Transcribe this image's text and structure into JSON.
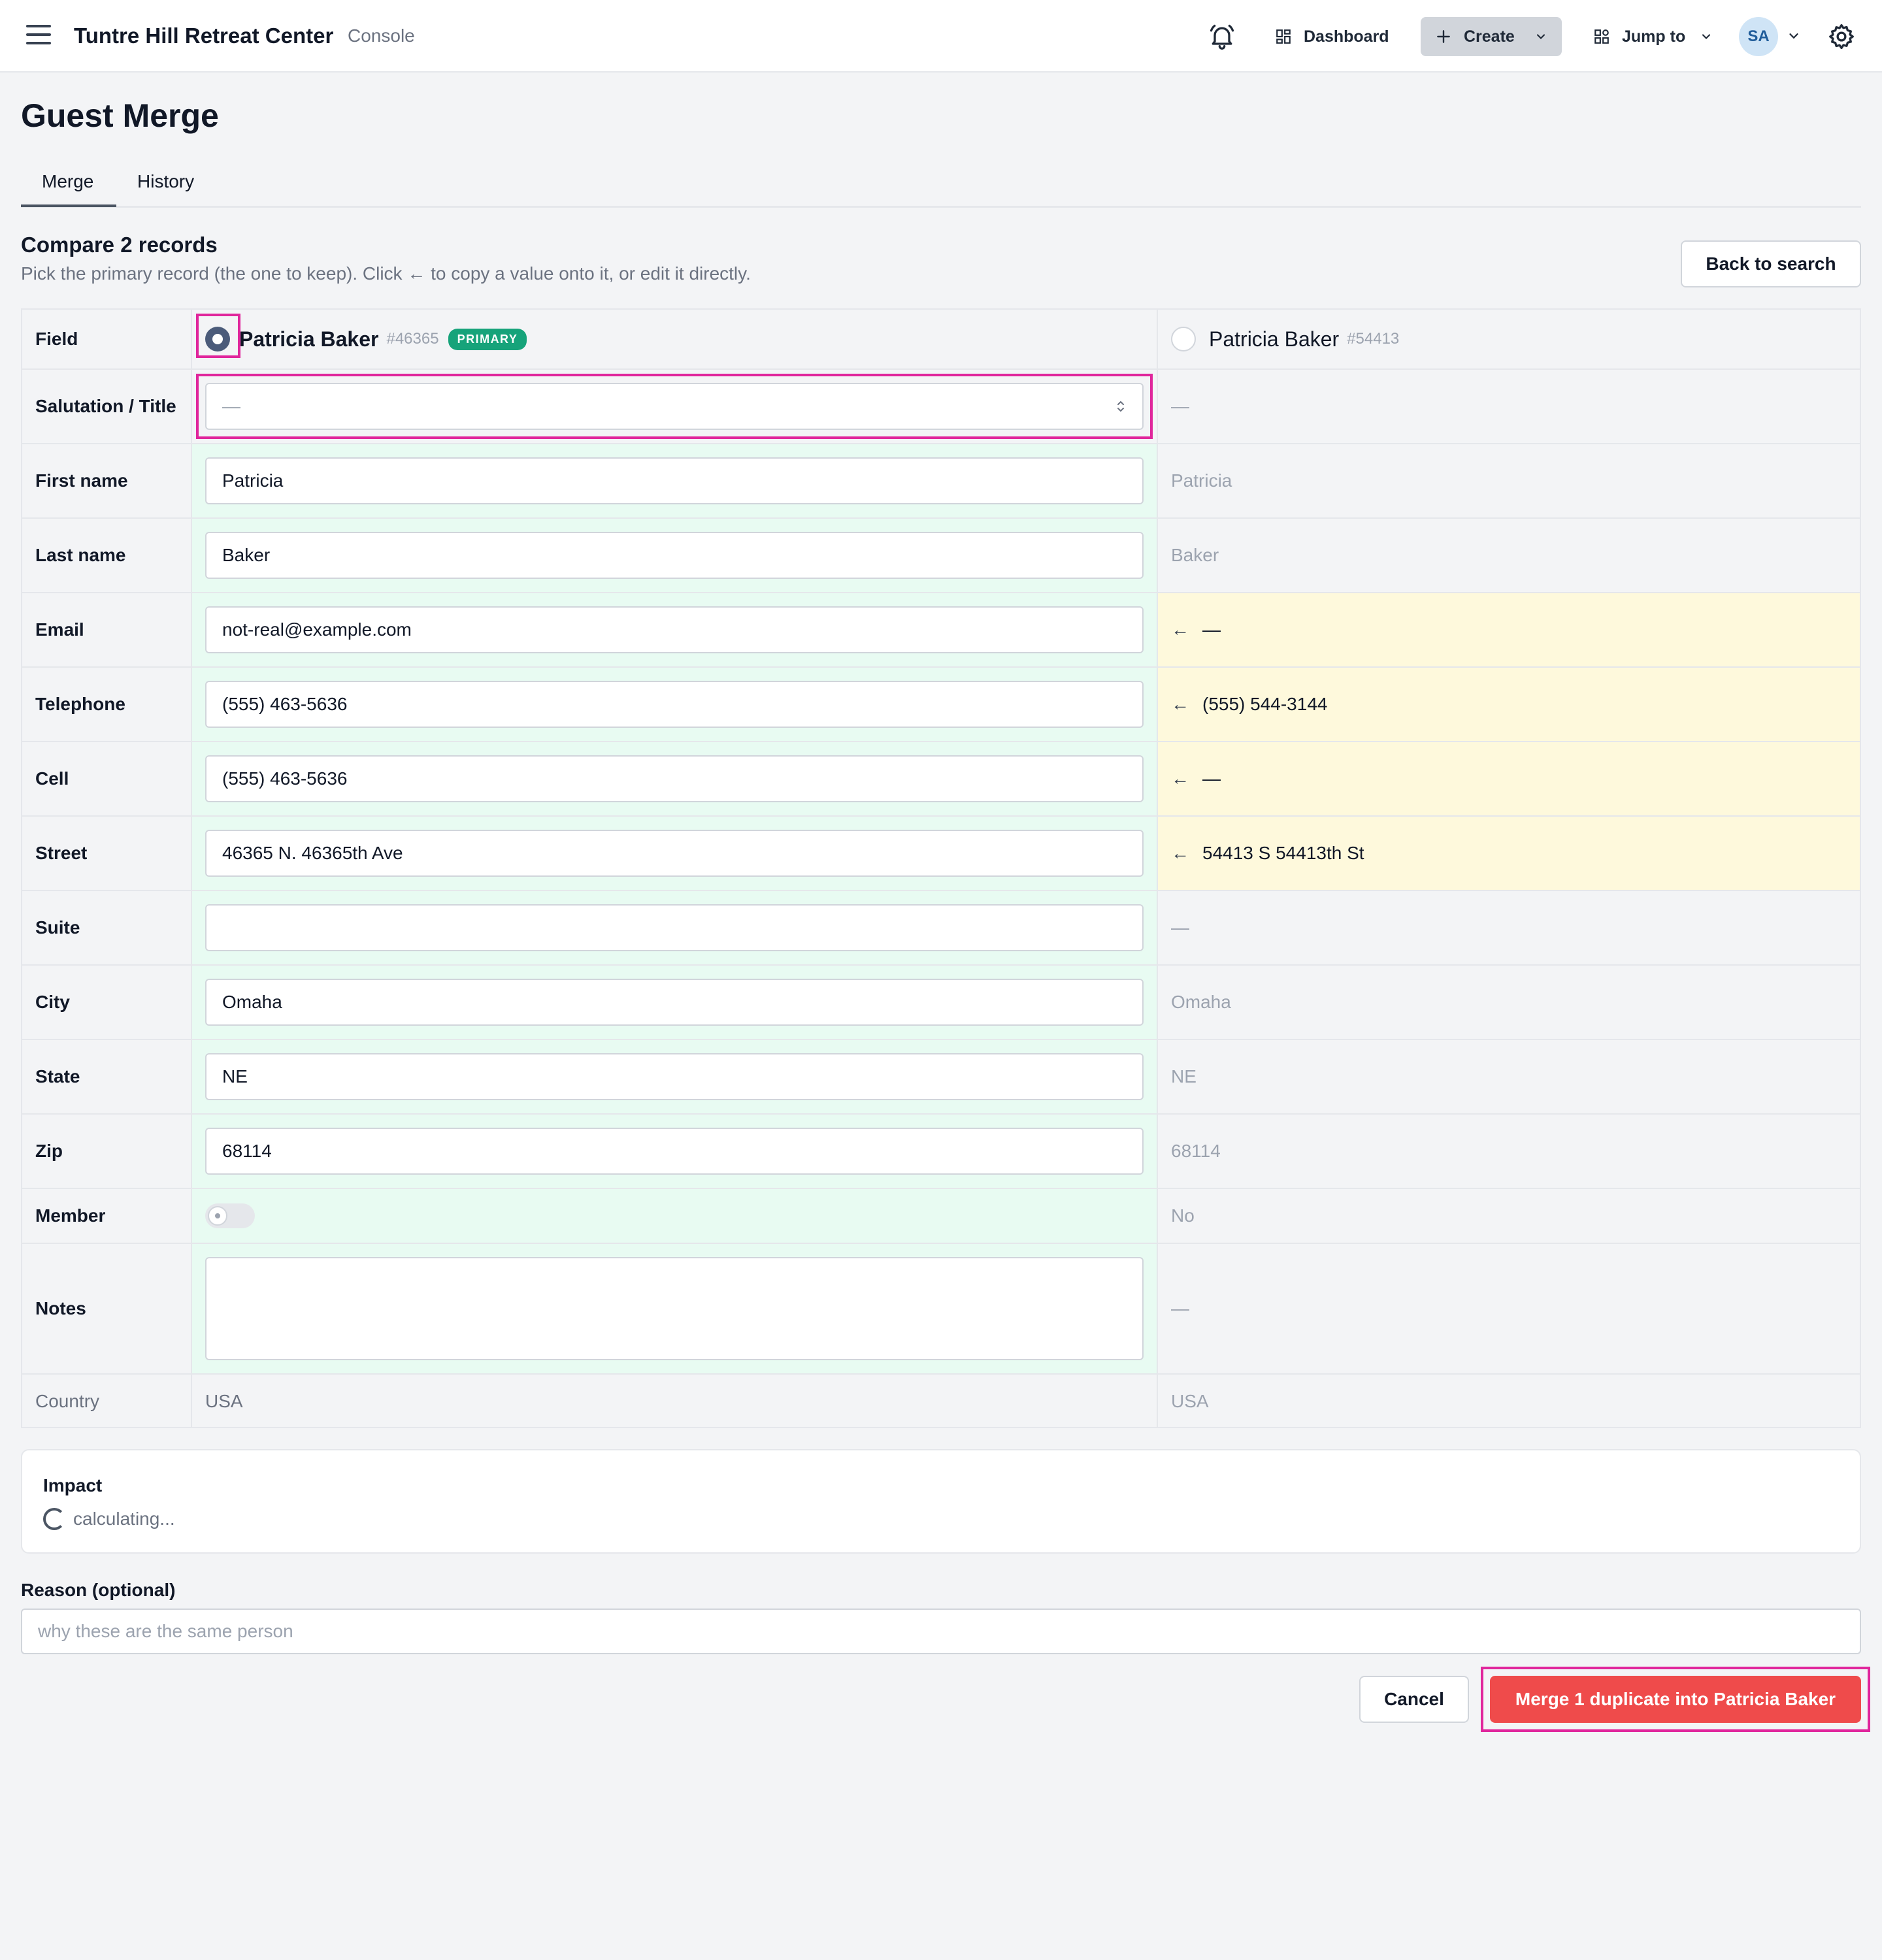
{
  "header": {
    "app_title": "Tuntre Hill Retreat Center",
    "app_subtitle": "Console",
    "dashboard_label": "Dashboard",
    "create_label": "Create",
    "jump_label": "Jump to",
    "avatar_initials": "SA"
  },
  "page": {
    "title": "Guest Merge",
    "tabs": [
      {
        "label": "Merge",
        "active": true
      },
      {
        "label": "History",
        "active": false
      }
    ]
  },
  "compare": {
    "title": "Compare 2 records",
    "subtitle": "Pick the primary record (the one to keep). Click ← to copy a value onto it, or edit it directly.",
    "back_label": "Back to search"
  },
  "records": {
    "field_header": "Field",
    "primary": {
      "name": "Patricia Baker",
      "id": "#46365",
      "badge": "PRIMARY"
    },
    "duplicate": {
      "name": "Patricia Baker",
      "id": "#54413"
    }
  },
  "rows": [
    {
      "label": "Salutation / Title",
      "primary": "—",
      "duplicate": "—"
    },
    {
      "label": "First name",
      "primary": "Patricia",
      "duplicate": "Patricia"
    },
    {
      "label": "Last name",
      "primary": "Baker",
      "duplicate": "Baker"
    },
    {
      "label": "Email",
      "primary": "not-real@example.com",
      "duplicate": "—",
      "copy_arrow": "←"
    },
    {
      "label": "Telephone",
      "primary": "(555) 463-5636",
      "duplicate": "(555) 544-3144",
      "copy_arrow": "←"
    },
    {
      "label": "Cell",
      "primary": "(555) 463-5636",
      "duplicate": "—",
      "copy_arrow": "←"
    },
    {
      "label": "Street",
      "primary": "46365 N. 46365th Ave",
      "duplicate": "54413 S 54413th St",
      "copy_arrow": "←"
    },
    {
      "label": "Suite",
      "primary": "",
      "duplicate": "—"
    },
    {
      "label": "City",
      "primary": "Omaha",
      "duplicate": "Omaha"
    },
    {
      "label": "State",
      "primary": "NE",
      "duplicate": "NE"
    },
    {
      "label": "Zip",
      "primary": "68114",
      "duplicate": "68114"
    },
    {
      "label": "Member",
      "primary_checked": false,
      "duplicate": "No"
    },
    {
      "label": "Notes",
      "primary": "",
      "duplicate": "—"
    },
    {
      "label": "Country",
      "primary": "USA",
      "duplicate": "USA"
    }
  ],
  "impact": {
    "title": "Impact",
    "status": "calculating..."
  },
  "reason": {
    "label": "Reason (optional)",
    "placeholder": "why these are the same person",
    "value": ""
  },
  "actions": {
    "cancel_label": "Cancel",
    "merge_label": "Merge 1 duplicate into Patricia Baker"
  },
  "colors": {
    "primary_column": "#e8fbf2",
    "diff_column": "#fef9dc",
    "merge_button": "#ef4b4b",
    "badge": "#16a37a",
    "highlight": "#e0269c"
  }
}
